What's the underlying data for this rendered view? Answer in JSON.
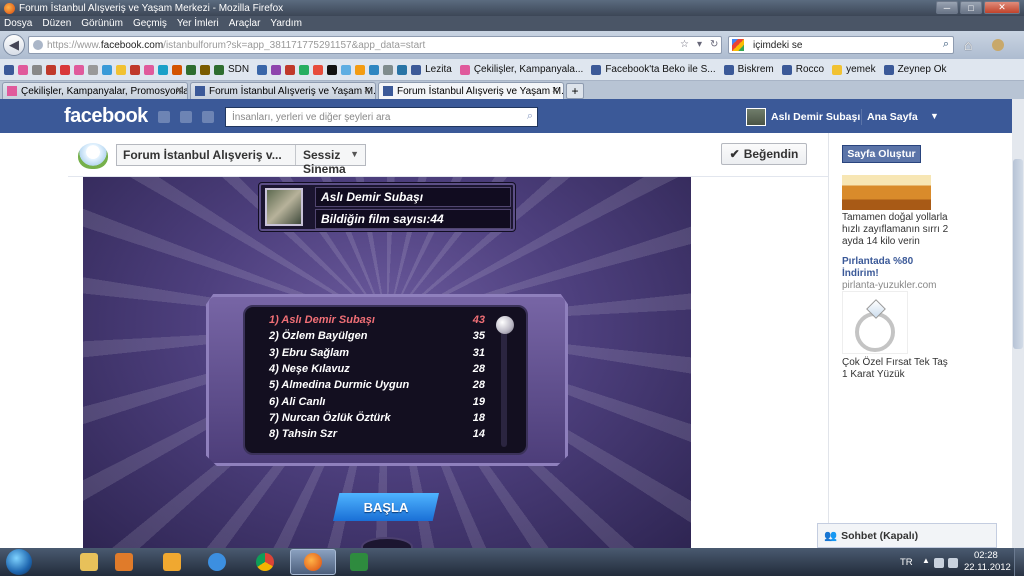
{
  "window": {
    "title": "Forum İstanbul Alışveriş ve Yaşam Merkezi - Mozilla Firefox",
    "menu": [
      "Dosya",
      "Düzen",
      "Görünüm",
      "Geçmiş",
      "Yer İmleri",
      "Araçlar",
      "Yardım"
    ],
    "controls": {
      "minimize": "─",
      "maximize": "□",
      "close": "✕"
    }
  },
  "navbar": {
    "url_prefix": "https://www.",
    "url_host": "facebook.com",
    "url_rest": "/istanbulforum?sk=app_381171775291157&app_data=start",
    "search_value": "içimdeki se"
  },
  "bookmarks": {
    "items": [
      {
        "label": "SDN",
        "color": "#2f6e2f"
      },
      {
        "label": "Lezita",
        "color": "#3b5998"
      },
      {
        "label": "Çekilişler, Kampanyala...",
        "color": "#e05a9c"
      },
      {
        "label": "Facebook'ta Beko ile S...",
        "color": "#3b5998"
      },
      {
        "label": "Biskrem",
        "color": "#3b5998"
      },
      {
        "label": "Rocco",
        "color": "#3b5998"
      },
      {
        "label": "yemek",
        "color": "#f1c232"
      },
      {
        "label": "Zeynep Ok",
        "color": "#3b5998"
      }
    ]
  },
  "tabs": [
    {
      "label": "Çekilişler, Kampanyalar, Promosyonla...",
      "icon": "pink-square-icon",
      "active": false
    },
    {
      "label": "Forum İstanbul Alışveriş ve Yaşam M...",
      "icon": "facebook-icon",
      "active": false
    },
    {
      "label": "Forum İstanbul Alışveriş ve Yaşam M...",
      "icon": "facebook-icon",
      "active": true
    }
  ],
  "new_tab": "+",
  "facebook": {
    "logo": "facebook",
    "search_placeholder": "İnsanları, yerleri ve diğer şeyleri ara",
    "user_name": "Aslı Demir Subaşı",
    "home": "Ana Sayfa",
    "app_page_name": "Forum İstanbul Alışveriş v...",
    "app_name": "Sessiz Sinema",
    "like_button": "Beğendin"
  },
  "game": {
    "player_name": "Aslı Demir Subaşı",
    "films_known": "Bildiğin film sayısı:44",
    "leaderboard": [
      {
        "rank": "1) Aslı Demir Subaşı",
        "score": "43",
        "highlight": true
      },
      {
        "rank": "2) Özlem Bayülgen",
        "score": "35",
        "highlight": false
      },
      {
        "rank": "3) Ebru Sağlam",
        "score": "31",
        "highlight": false
      },
      {
        "rank": "4) Neşe Kılavuz",
        "score": "28",
        "highlight": false
      },
      {
        "rank": "5) Almedina Durmic Uygun",
        "score": "28",
        "highlight": false
      },
      {
        "rank": "6) Ali Canlı",
        "score": "19",
        "highlight": false
      },
      {
        "rank": "7) Nurcan Özlük Öztürk",
        "score": "18",
        "highlight": false
      },
      {
        "rank": "8) Tahsin Szr",
        "score": "14",
        "highlight": false
      }
    ],
    "start_button": "BAŞLA"
  },
  "sidebar": {
    "create_page": "Sayfa Oluştur",
    "ad1_text": "Tamamen doğal yollarla hızlı zayıflamanın sırrı 2 ayda 14 kilo verin",
    "ad2_title": "Pırlantada %80 İndirim!",
    "ad2_domain": "pirlanta-yuzukler.com",
    "ad2_text": "Çok Özel Fırsat Tek Taş 1 Karat Yüzük"
  },
  "chat": {
    "label": "Sohbet (Kapalı)"
  },
  "taskbar": {
    "lang": "TR",
    "time": "02:28",
    "date": "22.11.2012",
    "apps": [
      {
        "name": "explorer-icon",
        "color": "#e8c15a",
        "active": false
      },
      {
        "name": "media-player-icon",
        "color": "#e07b2a",
        "active": false
      },
      {
        "name": "outlook-icon",
        "color": "#f0a830",
        "active": false
      },
      {
        "name": "internet-explorer-icon",
        "color": "#3c8fe0",
        "active": false
      },
      {
        "name": "chrome-icon",
        "color": "#46a34a",
        "active": false
      },
      {
        "name": "firefox-icon",
        "color": "#e8641b",
        "active": true
      },
      {
        "name": "excel-icon",
        "color": "#2e8b3e",
        "active": false
      }
    ]
  }
}
